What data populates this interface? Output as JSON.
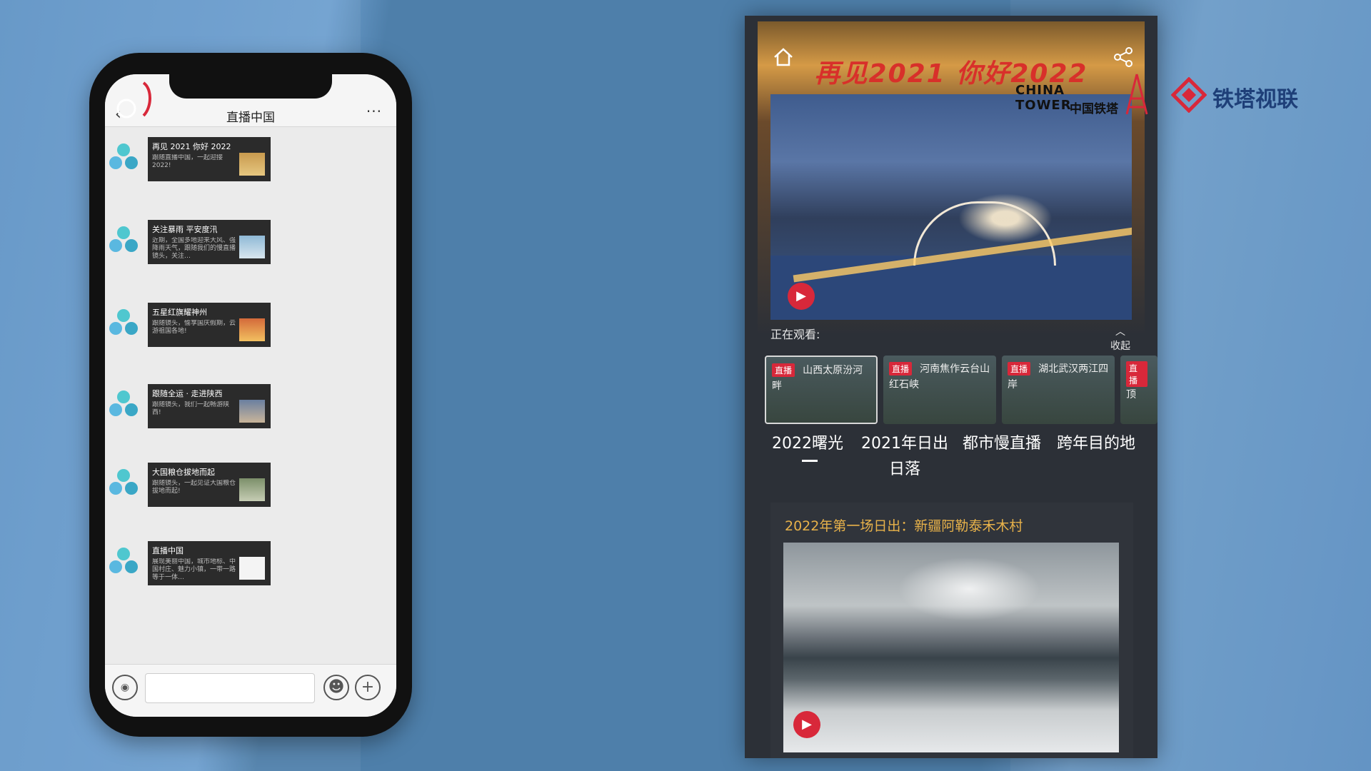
{
  "chat": {
    "title": "直播中国",
    "more": "···",
    "back": "‹",
    "messages": [
      {
        "title": "再见 2021 你好 2022",
        "desc": "跟随直播中国，一起迎接2022!"
      },
      {
        "title": "关注暴雨 平安度汛",
        "desc": "近期，全国多地迎来大风、强降雨天气，跟随我们的慢直播镜头，关注…"
      },
      {
        "title": "五星红旗耀神州",
        "desc": "跟随镜头，愉享国庆假期，云游祖国各地!"
      },
      {
        "title": "跟随全运 · 走进陕西",
        "desc": "跟随镜头，我们一起畅游陕西!"
      },
      {
        "title": "大国粮仓拔地而起",
        "desc": "跟随镜头，一起见证大国粮仓拔地而起!"
      },
      {
        "title": "直播中国",
        "desc": "展现美丽中国，城市地标、中国村庄、魅力小镇，一带一路等于一体…"
      }
    ]
  },
  "app": {
    "banner_title": "再见2021 你好2022",
    "watching_label": "正在观看:",
    "collapse_label": "收起",
    "live_tag": "直播",
    "live_cards": [
      {
        "text": "山西太原汾河畔"
      },
      {
        "text": "河南焦作云台山红石峡"
      },
      {
        "text": "湖北武汉两江四岸"
      },
      {
        "text": "顶"
      }
    ],
    "categories": [
      "2022曙光",
      "2021年日出日落",
      "都市慢直播",
      "跨年目的地"
    ],
    "feature_title": "2022年第一场日出：新疆阿勒泰禾木村"
  },
  "logos": {
    "china_tower_en": "CHINA TOWER",
    "china_tower_zh": "中国铁塔",
    "tieta_shilian": "铁塔视联"
  },
  "colors": {
    "accent_red": "#d8283a",
    "feature_gold": "#e8b24a",
    "brand_blue": "#1e3f78"
  }
}
